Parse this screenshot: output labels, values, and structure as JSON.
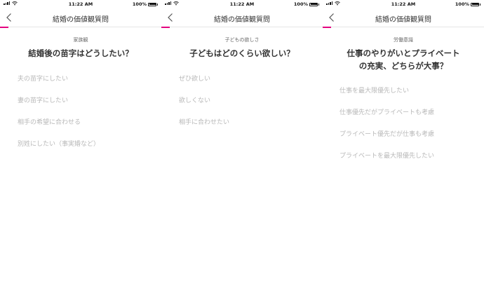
{
  "status_bar": {
    "time": "11:22 AM",
    "battery": "100%"
  },
  "nav": {
    "title": "結婚の価値観質問"
  },
  "screens": [
    {
      "progress": 0.05,
      "category": "家族観",
      "question_lines": [
        "結婚後の苗字はどうしたい？"
      ],
      "options": [
        "夫の苗字にしたい",
        "妻の苗字にしたい",
        "相手の希望に合わせる",
        "別姓にしたい（事実婚など）"
      ]
    },
    {
      "progress": 0.05,
      "category": "子どもの欲しさ",
      "question_lines": [
        "子どもはどのくらい欲しい？"
      ],
      "options": [
        "ぜひ欲しい",
        "欲しくない",
        "相手に合わせたい"
      ]
    },
    {
      "progress": 0.05,
      "category": "労働意識",
      "question_lines": [
        "仕事のやりがいとプライベート",
        "の充実、どちらが大事？"
      ],
      "options": [
        "仕事を最大限優先したい",
        "仕事優先だがプライベートも考慮",
        "プライベート優先だが仕事も考慮",
        "プライベートを最大限優先したい"
      ]
    }
  ],
  "colors": {
    "accent": "#e4007f",
    "option_text": "#b8b8b8",
    "title_text": "#333333"
  }
}
